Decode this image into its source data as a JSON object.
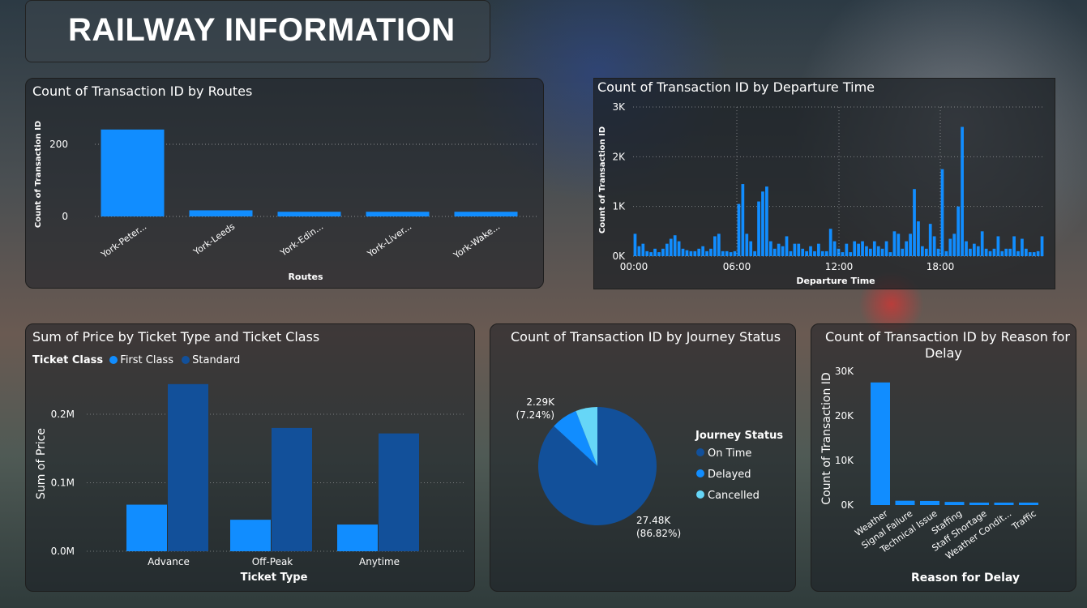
{
  "header": {
    "title": "RAILWAY INFORMATION"
  },
  "colors": {
    "first": "#118DFF",
    "standard": "#12509A",
    "delayed": "#1F8EF1",
    "cancelled": "#66D6F7",
    "axis_text": "#ffffff"
  },
  "routes_chart": {
    "title": "Count of Transaction ID by Routes",
    "chart_data": {
      "type": "bar",
      "categories": [
        "York-Peter...",
        "York-Leeds",
        "York-Edin...",
        "York-Liver...",
        "York-Wake..."
      ],
      "values": [
        241,
        17,
        13,
        13,
        13
      ],
      "ylabel": "Count of Transaction ID",
      "xlabel": "Routes",
      "yticks": [
        "0",
        "200"
      ],
      "grid": true
    }
  },
  "departure_chart": {
    "title": "Count of Transaction ID by Departure Time",
    "chart_data": {
      "type": "bar",
      "x_tick_labels": [
        "00:00",
        "06:00",
        "12:00",
        "18:00"
      ],
      "yticks": [
        "0K",
        "1K",
        "2K",
        "3K"
      ],
      "ylabel": "Count of Transaction ID",
      "xlabel": "Departure Time",
      "values": [
        450,
        200,
        250,
        100,
        80,
        150,
        80,
        150,
        250,
        350,
        420,
        300,
        150,
        120,
        100,
        100,
        150,
        200,
        100,
        150,
        400,
        450,
        100,
        100,
        80,
        100,
        1050,
        1450,
        450,
        300,
        100,
        1100,
        1300,
        1400,
        300,
        150,
        250,
        200,
        400,
        100,
        250,
        250,
        150,
        100,
        200,
        100,
        250,
        100,
        100,
        550,
        300,
        150,
        80,
        250,
        80,
        300,
        250,
        300,
        200,
        150,
        300,
        200,
        150,
        300,
        80,
        500,
        450,
        150,
        300,
        450,
        1350,
        700,
        200,
        150,
        650,
        400,
        150,
        1750,
        100,
        350,
        450,
        1000,
        2600,
        300,
        150,
        250,
        200,
        500,
        150,
        100,
        150,
        400,
        100,
        150,
        150,
        400,
        100,
        350,
        150,
        80,
        80,
        100,
        400
      ],
      "grid": true
    }
  },
  "ticket_chart": {
    "title": "Sum of Price by Ticket Type and Ticket Class",
    "legend_title": "Ticket Class",
    "chart_data": {
      "type": "bar",
      "categories": [
        "Advance",
        "Off-Peak",
        "Anytime"
      ],
      "series": [
        {
          "name": "First Class",
          "values": [
            0.068,
            0.046,
            0.039
          ]
        },
        {
          "name": "Standard",
          "values": [
            0.244,
            0.18,
            0.172
          ]
        }
      ],
      "yticks": [
        "0.0M",
        "0.1M",
        "0.2M"
      ],
      "ylabel": "Sum of Price",
      "xlabel": "Ticket Type",
      "unit": "M"
    }
  },
  "status_chart": {
    "title": "Count of Transaction ID by Journey Status",
    "legend_title": "Journey Status",
    "chart_data": {
      "type": "pie",
      "slices": [
        {
          "name": "On Time",
          "value": 27480,
          "pct": 86.82
        },
        {
          "name": "Delayed",
          "value": 2290,
          "pct": 7.24
        },
        {
          "name": "Cancelled",
          "value": 1880,
          "pct": 5.94
        }
      ],
      "labels": [
        {
          "line1": "27.48K",
          "line2": "(86.82%)"
        },
        {
          "line1": "2.29K",
          "line2": "(7.24%)"
        }
      ]
    }
  },
  "delay_chart": {
    "title_line1": "Count of Transaction ID by Reason for",
    "title_line2": "Delay",
    "chart_data": {
      "type": "bar",
      "categories": [
        "Weather",
        "Signal Failure",
        "Technical Issue",
        "Staffing",
        "Staff Shortage",
        "Weather Condit...",
        "Traffic"
      ],
      "values": [
        27500,
        970,
        920,
        700,
        400,
        370,
        310
      ],
      "yticks": [
        "0K",
        "10K",
        "20K",
        "30K"
      ],
      "ylabel": "Count of Transaction ID",
      "xlabel": "Reason for Delay"
    }
  }
}
